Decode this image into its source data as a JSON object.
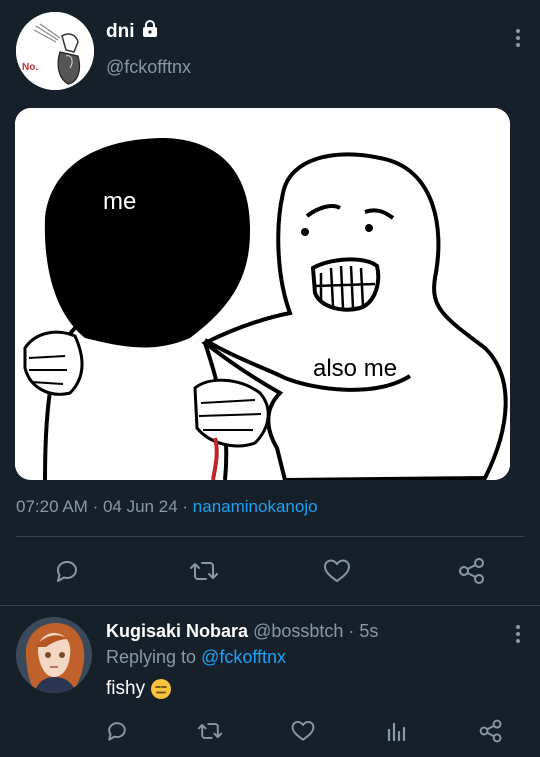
{
  "tweet": {
    "display_name": "dni",
    "handle": "@fckofftnx",
    "avatar_text": "No.",
    "media": {
      "label_me": "me",
      "label_also_me": "also me"
    },
    "time": "07:20 AM",
    "date": "04 Jun 24",
    "separator": "·",
    "via": "nanaminokanojo",
    "actions": [
      "reply-icon",
      "retweet-icon",
      "like-icon",
      "share-icon"
    ]
  },
  "reply": {
    "display_name": "Kugisaki Nobara",
    "handle": "@bossbtch",
    "age": "5s",
    "separator": "·",
    "replying_prefix": "Replying to",
    "replying_to": "@fckofftnx",
    "text": "fishy",
    "emoji": "expressionless-face-emoji",
    "actions": [
      "reply-icon",
      "retweet-icon",
      "like-icon",
      "analytics-icon",
      "share-icon"
    ]
  },
  "colors": {
    "background": "#15202b",
    "secondary_text": "#8899a6",
    "link": "#1da1f2",
    "divider": "#38444d"
  }
}
